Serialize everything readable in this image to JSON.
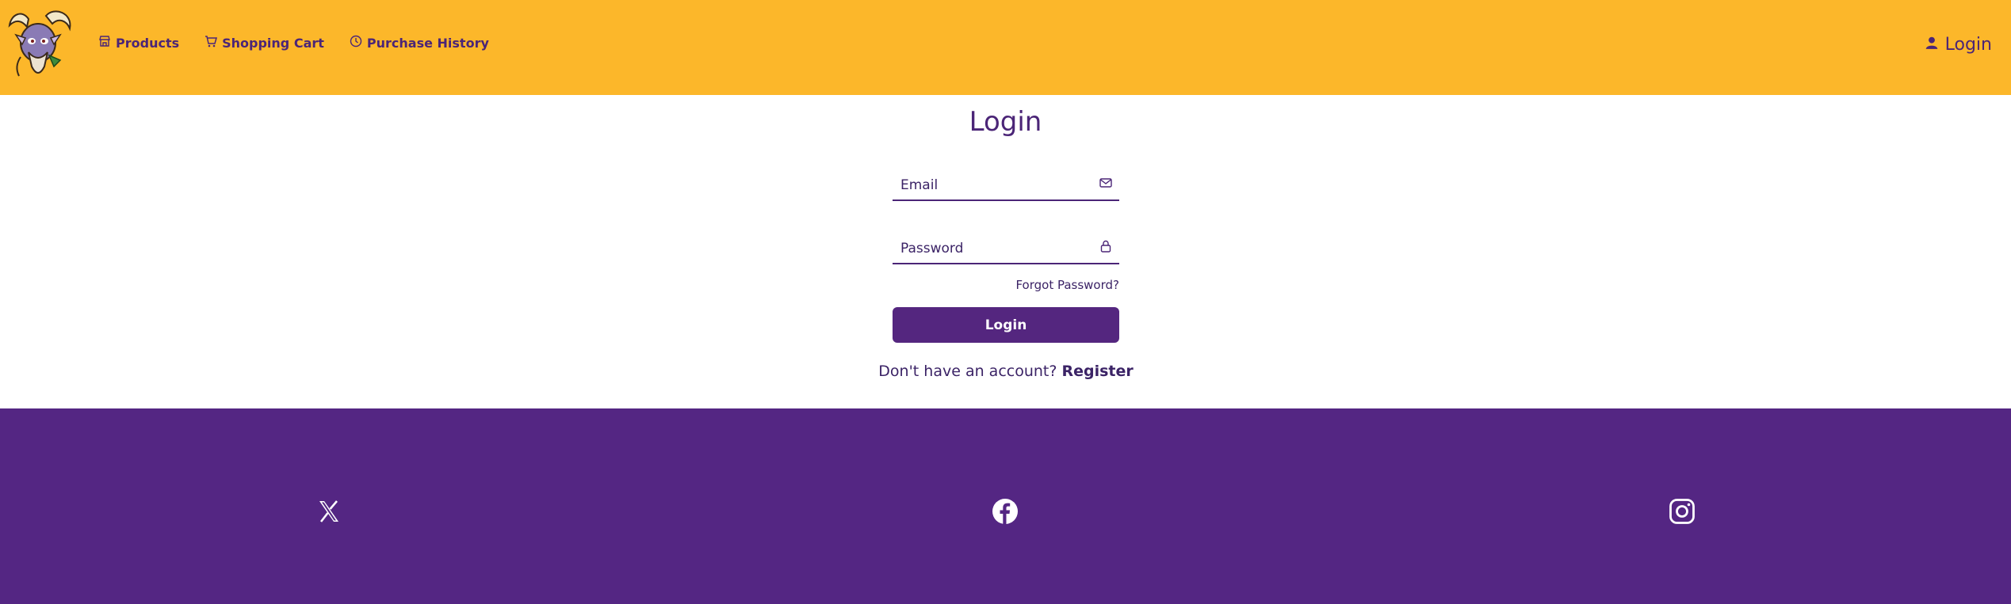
{
  "header": {
    "logo_icon": "goat-mascot-logo",
    "nav": [
      {
        "label": "Products",
        "icon": "store-icon"
      },
      {
        "label": "Shopping Cart",
        "icon": "cart-icon"
      },
      {
        "label": "Purchase History",
        "icon": "clock-icon"
      }
    ],
    "login_label": "Login",
    "login_icon": "user-icon"
  },
  "main": {
    "title": "Login",
    "email": {
      "label": "Email",
      "value": "",
      "icon": "mail-icon"
    },
    "password": {
      "label": "Password",
      "value": "",
      "icon": "lock-icon"
    },
    "forgot_label": "Forgot Password?",
    "submit_label": "Login",
    "no_account_text": "Don't have an account?",
    "register_label": "Register"
  },
  "footer": {
    "socials": [
      {
        "name": "x-twitter-icon"
      },
      {
        "name": "facebook-icon"
      },
      {
        "name": "instagram-icon"
      }
    ]
  },
  "colors": {
    "header_bg": "#fcb72a",
    "brand_purple": "#54267f",
    "footer_bg": "#542683",
    "text_purple": "#4b2577"
  }
}
